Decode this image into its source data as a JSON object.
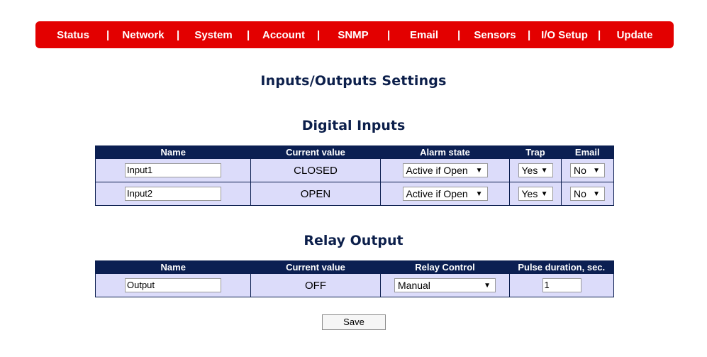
{
  "nav": {
    "items": [
      "Status",
      "Network",
      "System",
      "Account",
      "SNMP",
      "Email",
      "Sensors",
      "I/O Setup",
      "Update"
    ],
    "separator": "|"
  },
  "page_title": "Inputs/Outputs Settings",
  "digital_inputs": {
    "title": "Digital Inputs",
    "headers": [
      "Name",
      "Current value",
      "Alarm state",
      "Trap",
      "Email"
    ],
    "rows": [
      {
        "name": "Input1",
        "current": "CLOSED",
        "alarm": "Active if Open",
        "trap": "Yes",
        "email": "No"
      },
      {
        "name": "Input2",
        "current": "OPEN",
        "alarm": "Active if Open",
        "trap": "Yes",
        "email": "No"
      }
    ]
  },
  "relay_output": {
    "title": "Relay Output",
    "headers": [
      "Name",
      "Current value",
      "Relay Control",
      "Pulse duration, sec."
    ],
    "rows": [
      {
        "name": "Output",
        "current": "OFF",
        "control": "Manual",
        "pulse": "1"
      }
    ]
  },
  "save_label": "Save",
  "icons": {
    "dropdown_arrow": "▼"
  },
  "colors": {
    "nav_bg": "#e30000",
    "header_bg": "#0b1f52",
    "cell_bg": "#dcdcfa",
    "title_color": "#0c1f4b"
  }
}
